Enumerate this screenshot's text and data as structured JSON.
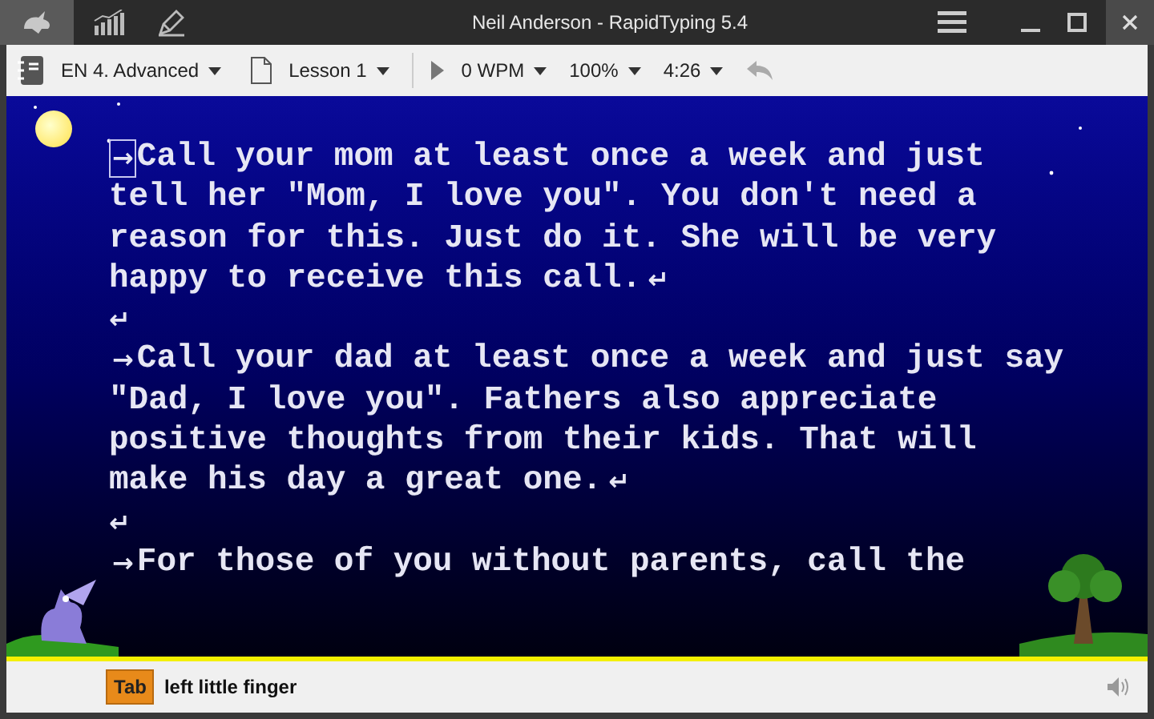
{
  "window": {
    "title": "Neil Anderson - RapidTyping 5.4"
  },
  "toolbar": {
    "course": "EN 4. Advanced",
    "lesson": "Lesson 1",
    "speed": "0 WPM",
    "accuracy": "100%",
    "time": "4:26"
  },
  "lines": [
    {
      "tab_mark": "→",
      "text": "Call your mom at least once a week and just",
      "cursor": true
    },
    {
      "text": "tell her \"Mom, I love you\". You don't need a",
      "cursor": false
    },
    {
      "text": "reason for this. Just do it. She will be very",
      "cursor": false
    },
    {
      "text": "happy to receive this call.",
      "return_mark": "↵",
      "cursor": false
    },
    {
      "return_mark": "↵",
      "cursor": false
    },
    {
      "tab_mark": "→",
      "text": "Call your dad at least once a week and just say",
      "cursor": false
    },
    {
      "text": "\"Dad, I love you\". Fathers also appreciate",
      "cursor": false
    },
    {
      "text": "positive thoughts from their kids. That will",
      "cursor": false
    },
    {
      "text": "make his day a great one.",
      "return_mark": "↵",
      "cursor": false
    },
    {
      "return_mark": "↵",
      "cursor": false
    },
    {
      "tab_mark": "→",
      "text": "For those of you without parents, call the",
      "cursor": false
    }
  ],
  "status_bar": {
    "key": "Tab",
    "finger": "left little finger"
  }
}
